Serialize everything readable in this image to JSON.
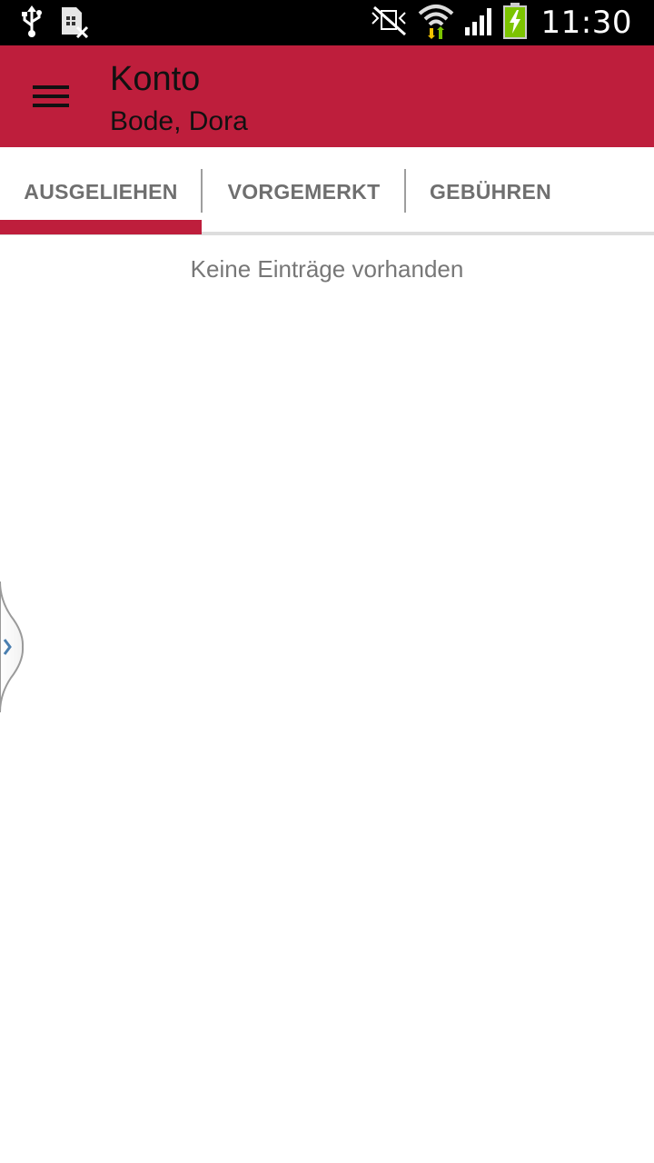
{
  "status_bar": {
    "time": "11:30",
    "icons": [
      "usb-icon",
      "sim-missing-icon",
      "nfc-muted-icon",
      "wifi-icon",
      "signal-icon",
      "battery-charging-icon"
    ]
  },
  "app_bar": {
    "menu_icon": "hamburger-menu-icon",
    "title": "Konto",
    "subtitle": "Bode, Dora",
    "background_color": "#be1e3c"
  },
  "tabs": [
    {
      "label": "AUSGELIEHEN",
      "selected": true
    },
    {
      "label": "VORGEMERKT",
      "selected": false
    },
    {
      "label": "GEBÜHREN",
      "selected": false
    }
  ],
  "content": {
    "empty_message": "Keine Einträge vorhanden"
  },
  "side_handle": {
    "icon": "chevron-right-icon"
  }
}
